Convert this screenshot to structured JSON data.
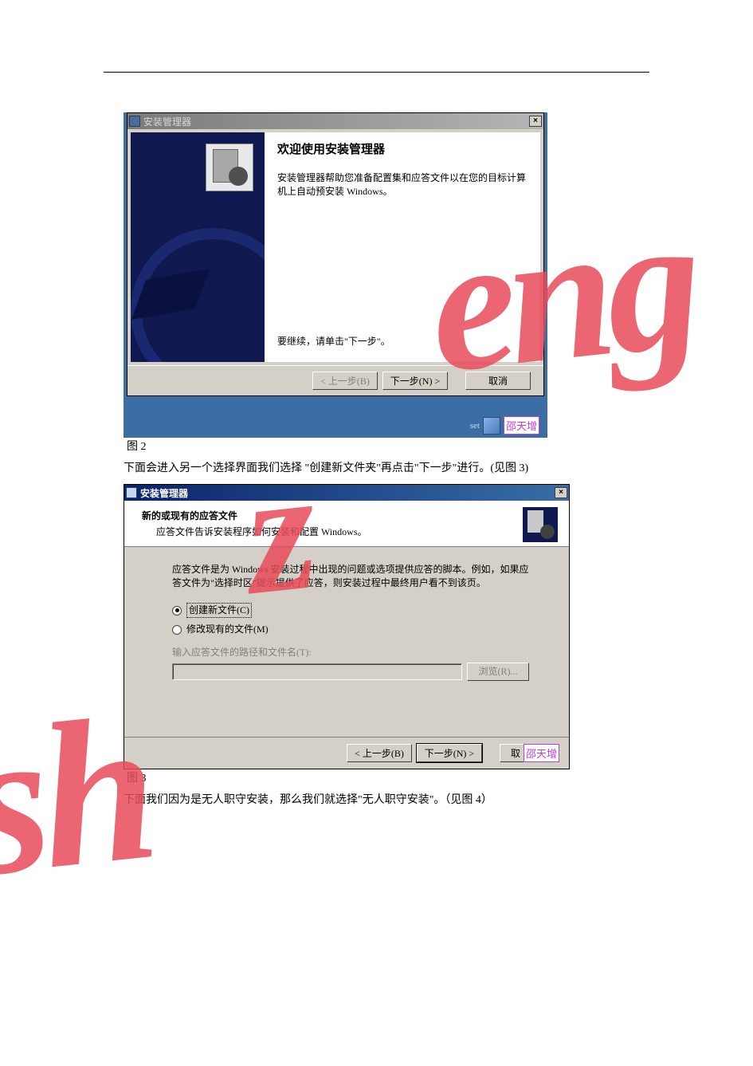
{
  "dialog1": {
    "titlebar": "安装管理器",
    "heading": "欢迎使用安装管理器",
    "desc": "安装管理器帮助您准备配置集和应答文件以在您的目标计算机上自动预安装 Windows。",
    "continue": "要继续，请单击\"下一步\"。",
    "buttons": {
      "back": "< 上一步(B)",
      "next": "下一步(N) >",
      "cancel": "取消"
    },
    "tray_text": "set",
    "name_tag": "邵天增"
  },
  "caption1_label": "图 2",
  "para1": "下面会进入另一个选择界面我们选择 \"创建新文件夹\"再点击\"下一步\"进行。(见图 3)",
  "dialog2": {
    "titlebar": "安装管理器",
    "header_title": "新的或现有的应答文件",
    "header_sub": "应答文件告诉安装程序如何安装和配置 Windows。",
    "desc": "应答文件是为 Windows 安装过程中出现的问题或选项提供应答的脚本。例如，如果应答文件为\"选择时区\"提示提供了应答，则安装过程中最终用户看不到该页。",
    "radio1": "创建新文件(C)",
    "radio2": "修改现有的文件(M)",
    "path_label": "输入应答文件的路径和文件名(T):",
    "browse": "浏览(R)...",
    "buttons": {
      "back": "< 上一步(B)",
      "next": "下一步(N) >",
      "cancel_partial": "取",
      "name_tag": "邵天增"
    }
  },
  "caption2_label": "图 3",
  "para2": "下面我们因为是无人职守安装，那么我们就选择\"无人职守安装\"。（见图 4）",
  "watermark": {
    "p1": "eng",
    "p2": "z",
    "p3": "sh"
  }
}
